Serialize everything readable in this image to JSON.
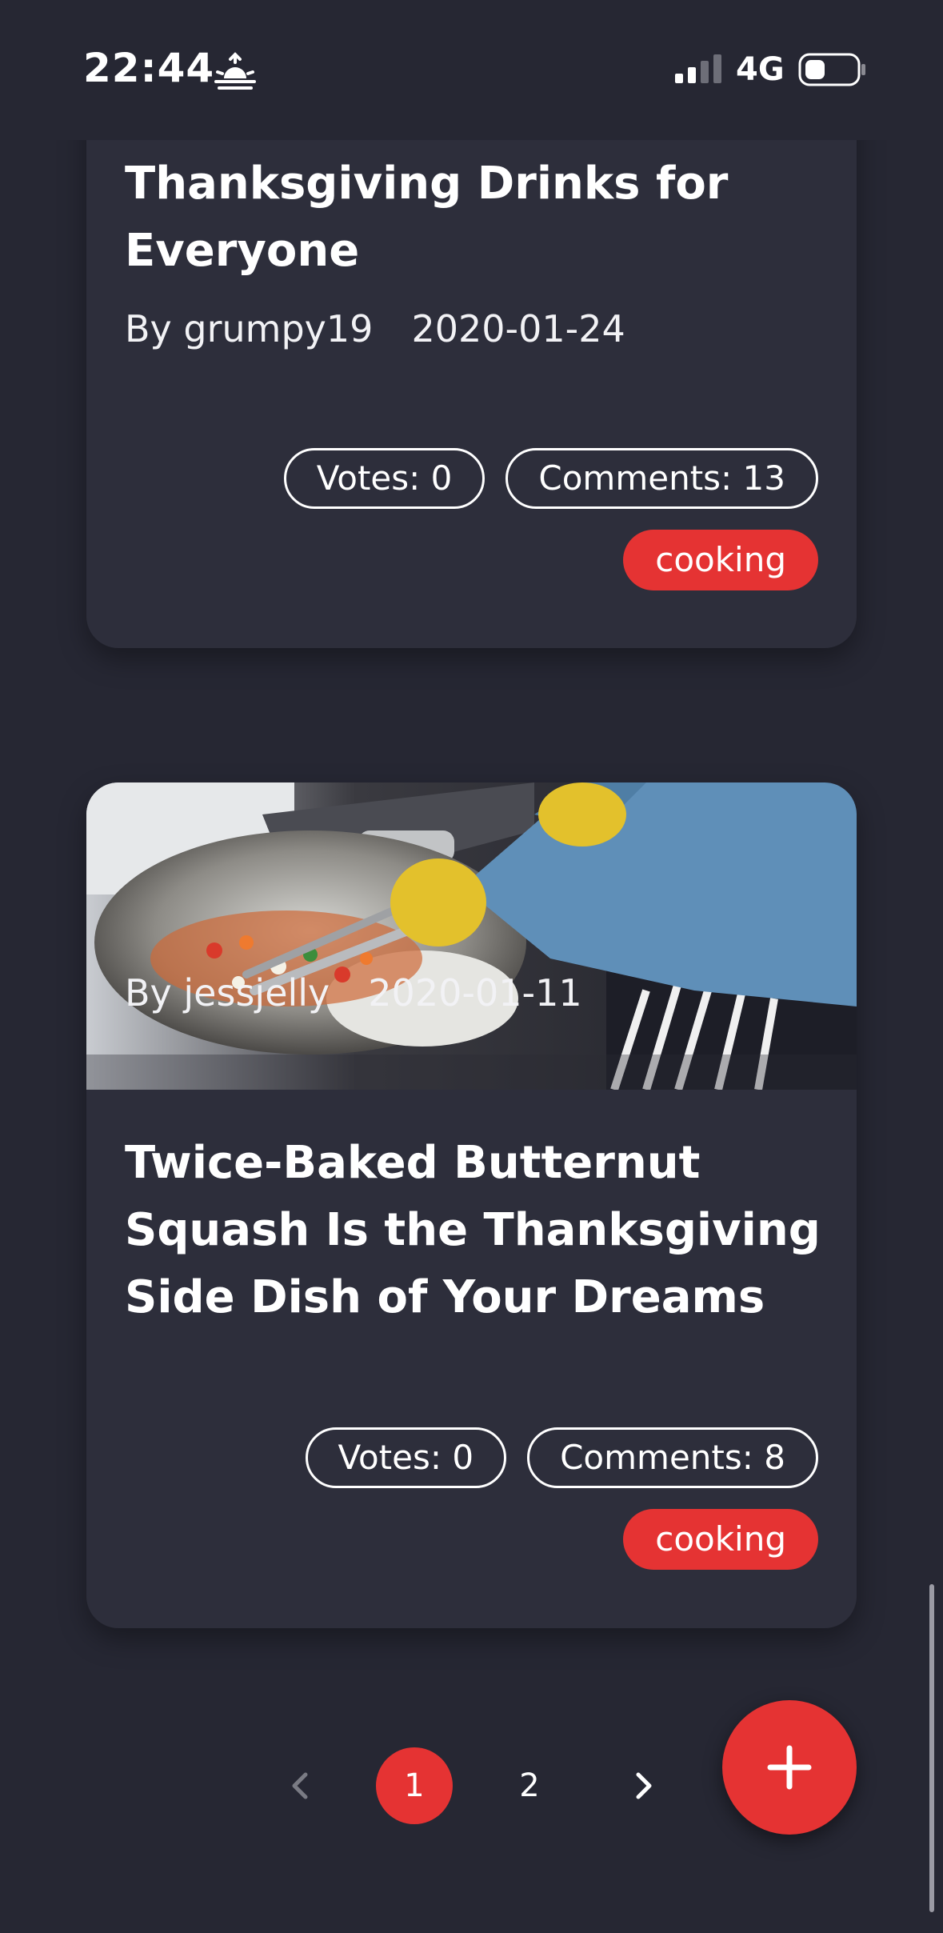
{
  "status_bar": {
    "time": "22:44",
    "network": "4G",
    "icons": [
      "sunrise-icon",
      "signal-icon",
      "battery-icon"
    ]
  },
  "posts": [
    {
      "title": "Thanksgiving Drinks for Everyone",
      "author": "By grumpy19",
      "date": "2020-01-24",
      "votes": "Votes: 0",
      "comments": "Comments: 13",
      "tag": "cooking"
    },
    {
      "title": "Twice-Baked Butternut Squash Is the Thanksgiving Side Dish of Your Dreams",
      "author": "By jessjelly",
      "date": "2020-01-11",
      "votes": "Votes: 0",
      "comments": "Comments: 8",
      "tag": "cooking",
      "image": "cooking-wok-photo"
    }
  ],
  "pagination": {
    "pages": [
      "1",
      "2"
    ],
    "current": "1"
  },
  "fab": {
    "icon": "plus-icon"
  },
  "colors": {
    "background": "#262733",
    "card": "#2d2e3b",
    "accent": "#e53333"
  }
}
